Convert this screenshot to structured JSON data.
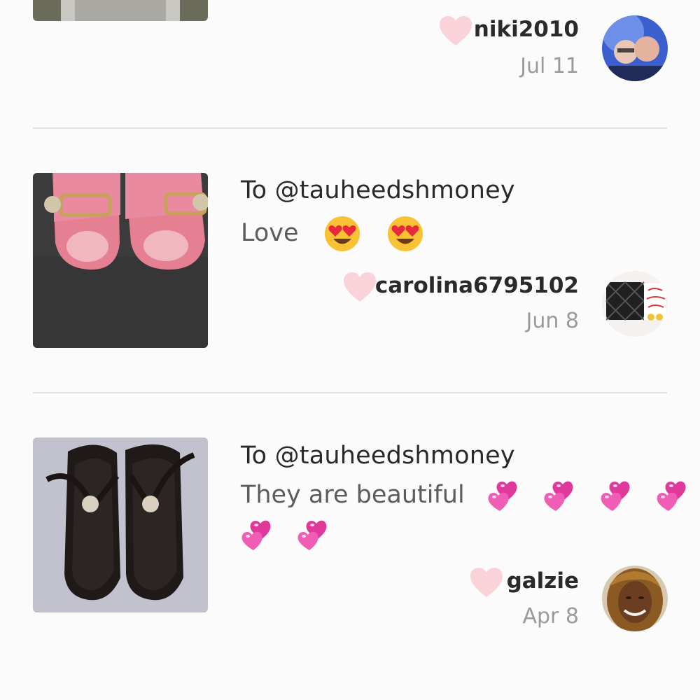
{
  "colors": {
    "heart": "#f9d3d9",
    "divider": "#e4e2e4",
    "username": "#2a2a2a",
    "message": "#5c5c5c",
    "date": "#9a9a9a"
  },
  "comments": [
    {
      "user": "niki2010",
      "date": "Jul 11",
      "heart_icon": "heart-outline-icon"
    },
    {
      "to": "To @tauheedshmoney",
      "message": "Love",
      "emojis": [
        "heart-eyes-emoji",
        "heart-eyes-emoji"
      ],
      "user": "carolina6795102",
      "date": "Jun 8",
      "heart_icon": "heart-outline-icon"
    },
    {
      "to": "To @tauheedshmoney",
      "message": "They are beautiful",
      "emojis": [
        "two-hearts-emoji",
        "two-hearts-emoji",
        "two-hearts-emoji",
        "two-hearts-emoji",
        "two-hearts-emoji",
        "two-hearts-emoji"
      ],
      "user": "galzie",
      "date": "Apr 8",
      "heart_icon": "heart-outline-icon"
    }
  ]
}
